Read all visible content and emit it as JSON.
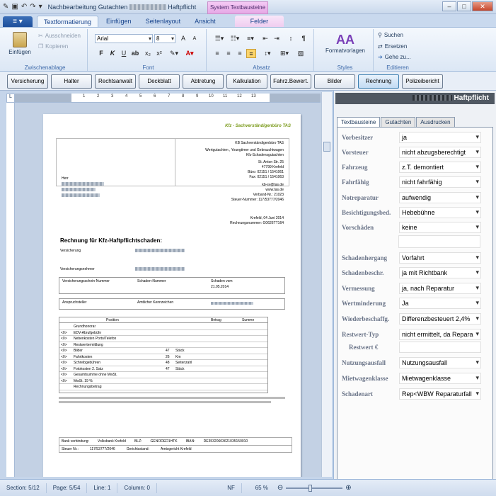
{
  "window": {
    "title_prefix": "Nachbearbeitung Gutachten",
    "title_suffix": "Haftpflicht",
    "context_group": "System Textbausteine"
  },
  "tabs": [
    "Textformatierung",
    "Einfügen",
    "Seitenlayout",
    "Ansicht",
    "Felder"
  ],
  "ribbon": {
    "clipboard": {
      "paste": "Einfügen",
      "cut": "Ausschneiden",
      "copy": "Kopieren",
      "label": "Zwischenablage"
    },
    "font": {
      "name": "Arial",
      "size": "8",
      "label": "Font"
    },
    "paragraph": {
      "label": "Absatz"
    },
    "styles": {
      "button": "Formatvorlagen",
      "label": "Styles"
    },
    "editing": {
      "search": "Suchen",
      "replace": "Ersetzen",
      "goto": "Gehe zu...",
      "label": "Editieren"
    }
  },
  "toolbar": [
    "Versicherung",
    "Halter",
    "Rechtsanwalt",
    "Deckblatt",
    "Abtretung",
    "Kalkulation",
    "Fahrz.Bewert.",
    "Bilder",
    "Rechnung",
    "Polizeibericht"
  ],
  "document": {
    "logo": "Kfz - Sachverständigenbüro TAS",
    "sender_line": "KB Sachverständigenbüro TAS",
    "header_lines": [
      "Wertgutachten , Youngtimer und Gebrauchtwagen",
      "Kfz-Schadensgutachten",
      "St. Anton Str. 25",
      "47799 Krefeld",
      "Büro: 02151 / 1541061",
      "Fax: 02151 / 1541063",
      "kb-sv@tas.de",
      "www.tas.de",
      "Verband-Nr.: 21023",
      "Steuer-Nummer: 117/53777/2046"
    ],
    "addressee_salutation": "Herr",
    "date_line": "Krefeld, 04 Juni 2014",
    "invoice_no": "Rechnungsnummer: G0626TT164",
    "title": "Rechnung für Kfz-Haftpflichtschaden:",
    "versicherung": "Versicherung",
    "versicherungsnehmer": "Versicherungsnehmer",
    "table1_headers": [
      "Versicherungsschein-Nummer",
      "Schaden-Nummer",
      "Schaden vom"
    ],
    "schaden_vom": "21.05.2014",
    "table2_headers": [
      "Anspruchsteller",
      "Amtlicher Kennzeichen"
    ],
    "positions_headers": [
      "Position",
      "Betrag",
      "Summe"
    ],
    "positions": [
      {
        "mark": "",
        "label": "Grundhonorar",
        "qty": "",
        "unit": ""
      },
      {
        "mark": "<0>",
        "label": "EDV-Abrufgebühr",
        "qty": "",
        "unit": ""
      },
      {
        "mark": "<0>",
        "label": "Nebenkosten Porto/Telefon",
        "qty": "",
        "unit": ""
      },
      {
        "mark": "<0>",
        "label": "Restwertermittlung",
        "qty": "",
        "unit": ""
      },
      {
        "mark": "<0>",
        "label": "Bilder",
        "qty": "47",
        "unit": "Stück"
      },
      {
        "mark": "<0>",
        "label": "Fahrtkosten",
        "qty": "26",
        "unit": "Km"
      },
      {
        "mark": "<0>",
        "label": "Schreibgebühren",
        "qty": "48",
        "unit": "Seitenzahl"
      },
      {
        "mark": "<0>",
        "label": "Fotokosten 2. Satz",
        "qty": "47",
        "unit": "Stück"
      },
      {
        "mark": "<0>",
        "label": "Gesamtsumme ohne MwSt.",
        "qty": "",
        "unit": ""
      },
      {
        "mark": "<0>",
        "label": "MwSt.  19 %",
        "qty": "",
        "unit": ""
      },
      {
        "mark": "",
        "label": "Rechnungsbetrag",
        "qty": "",
        "unit": ""
      }
    ],
    "footer_bank": [
      "Bank verbindung:",
      "Volksbank Krefeld",
      "BLZ:",
      "GENODED1HTK",
      "IBAN:",
      "DE35320603621035150010"
    ],
    "footer_tax": [
      "Steuer Nr.:",
      "117/53777/2046",
      "Gerichtsstand:",
      "Amtsgericht Krefeld"
    ]
  },
  "panel": {
    "title": "Haftpflicht",
    "tabs": [
      "Textbausteine",
      "Gutachten",
      "Ausdrucken"
    ],
    "fields": [
      {
        "label": "Vorbesitzer",
        "value": "ja"
      },
      {
        "label": "Vorsteuer",
        "value": "nicht abzugsberechtigt"
      },
      {
        "label": "Fahrzeug",
        "value": "z.T. demontiert"
      },
      {
        "label": "Fahrfähig",
        "value": "nicht fahrfähig"
      },
      {
        "label": "Notreparatur",
        "value": "aufwendig"
      },
      {
        "label": "Besichtigungsbed.",
        "value": "Hebebühne"
      },
      {
        "label": "Vorschäden",
        "value": "keine"
      },
      {
        "label": "Schadenhergang",
        "value": "Vorfahrt"
      },
      {
        "label": "Schadenbeschr.",
        "value": "ja mit Richtbank"
      },
      {
        "label": "Vermessung",
        "value": "ja, nach Reparatur"
      },
      {
        "label": "Wertminderung",
        "value": "Ja"
      },
      {
        "label": "Wiederbeschaffg.",
        "value": "Differenzbesteuert 2,4%"
      },
      {
        "label": "Restwert-Typ",
        "value": "nicht ermittelt, da Repara"
      },
      {
        "label": "Restwert €",
        "value": ""
      },
      {
        "label": "Nutzungsausfall",
        "value": "Nutzungsausfall"
      },
      {
        "label": "Mietwagenklasse",
        "value": "Mietwagenklasse"
      },
      {
        "label": "Schadenart",
        "value": "Rep<WBW Reparaturfall"
      }
    ]
  },
  "status": {
    "section": "Section: 5/12",
    "page": "Page: 5/54",
    "line": "Line: 1",
    "column": "Column: 0",
    "nf": "NF",
    "zoom": "65 %"
  }
}
